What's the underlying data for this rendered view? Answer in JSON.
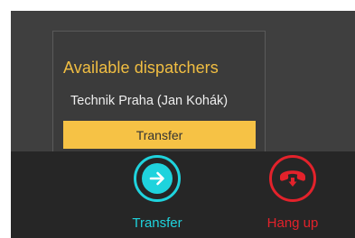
{
  "popup": {
    "title": "Available dispatchers",
    "dispatchers": [
      {
        "label": "Technik Praha (Jan Kohák)"
      }
    ],
    "transfer_button_label": "Transfer"
  },
  "actions": {
    "transfer": {
      "label": "Transfer",
      "icon": "arrow-right-icon",
      "color": "#1fd3dd"
    },
    "hangup": {
      "label": "Hang up",
      "icon": "phone-hangup-icon",
      "color": "#e3222b"
    }
  },
  "colors": {
    "accent": "#f1be42",
    "button_bg": "#f6c245",
    "background": "#3f3f3f",
    "bottom_bar": "#262626"
  }
}
